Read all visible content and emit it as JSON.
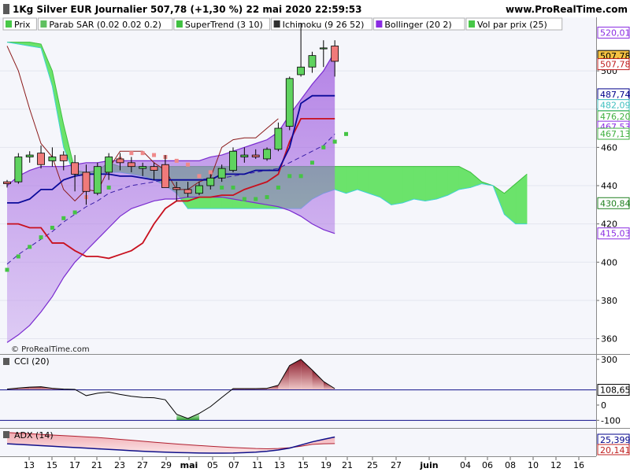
{
  "header": {
    "title": "1Kg Silver EUR Journalier 507,78 (+1,30 %) 22 mai 2020 22:59:53",
    "site": "www.ProRealTime.com"
  },
  "legend": [
    {
      "label": "Prix",
      "color": "#48c848"
    },
    {
      "label": "Parab SAR (0.02 0.02 0.2)",
      "color": "#60c060"
    },
    {
      "label": "SuperTrend (3 10)",
      "color": "#40c040"
    },
    {
      "label": "Ichimoku (9 26 52)",
      "color": "#303030"
    },
    {
      "label": "Bollinger (20 2)",
      "color": "#8a2be2"
    },
    {
      "label": "Vol par prix (25)",
      "color": "#48c848"
    }
  ],
  "watermark": "© ProRealTime.com",
  "chart_data": [
    {
      "type": "candlestick",
      "title": "",
      "x": [
        "13",
        "14",
        "15",
        "16",
        "17",
        "20",
        "21",
        "22",
        "23",
        "24",
        "27",
        "28",
        "29",
        "30",
        "mai",
        "04",
        "05",
        "06",
        "07",
        "08",
        "11",
        "12",
        "13",
        "14",
        "15",
        "18",
        "19",
        "20",
        "21",
        "22"
      ],
      "ohlc": [
        [
          442,
          443,
          439,
          441
        ],
        [
          442,
          457,
          441,
          455
        ],
        [
          455,
          458,
          452,
          456
        ],
        [
          457,
          461,
          449,
          451
        ],
        [
          453,
          460,
          450,
          455
        ],
        [
          456,
          458,
          448,
          453
        ],
        [
          452,
          456,
          437,
          446
        ],
        [
          447,
          451,
          430,
          437
        ],
        [
          436,
          452,
          435,
          450
        ],
        [
          447,
          457,
          443,
          455
        ],
        [
          454,
          457,
          448,
          452
        ],
        [
          452,
          455,
          447,
          450
        ],
        [
          449,
          452,
          445,
          450
        ],
        [
          450,
          452,
          443,
          448
        ],
        [
          451,
          456,
          442,
          439
        ],
        [
          439,
          442,
          432,
          438
        ],
        [
          438,
          442,
          434,
          436
        ],
        [
          436,
          442,
          435,
          440
        ],
        [
          440,
          446,
          438,
          444
        ],
        [
          444,
          451,
          442,
          449
        ],
        [
          448,
          460,
          447,
          458
        ],
        [
          455,
          460,
          452,
          456
        ],
        [
          456,
          459,
          454,
          455
        ],
        [
          454,
          460,
          453,
          459
        ],
        [
          459,
          473,
          458,
          470
        ],
        [
          471,
          497,
          469,
          496
        ],
        [
          498,
          525,
          497,
          502
        ],
        [
          502,
          510,
          499,
          508
        ],
        [
          512,
          516,
          502,
          512
        ],
        [
          513,
          516,
          497,
          505
        ]
      ],
      "price_axis": {
        "ticks": [
          360,
          380,
          400,
          420,
          440,
          460,
          480,
          500
        ],
        "range": [
          352,
          528
        ]
      },
      "price_labels": [
        {
          "text": "520,01",
          "value": 520.01,
          "color": "#8a2be2"
        },
        {
          "text": "507,78",
          "value": 507.78,
          "color": "#000000",
          "bg": "#f5c242"
        },
        {
          "text": "507,78",
          "value": 503.5,
          "color": "#c02020"
        },
        {
          "text": "487,74",
          "value": 487.74,
          "color": "#00008b"
        },
        {
          "text": "482,09",
          "value": 482.09,
          "color": "#40c0c0"
        },
        {
          "text": "476,20",
          "value": 476.2,
          "color": "#40b040"
        },
        {
          "text": "467,53",
          "value": 470.8,
          "color": "#8a2be2"
        },
        {
          "text": "467,13",
          "value": 467.13,
          "color": "#40b040"
        },
        {
          "text": "430,84",
          "value": 430.84,
          "color": "#208020"
        },
        {
          "text": "415,03",
          "value": 415.03,
          "color": "#8a2be2"
        }
      ],
      "bollinger_upper": [
        440,
        445,
        448,
        450,
        450,
        450,
        451,
        452,
        452,
        453,
        453,
        453,
        453,
        453,
        453,
        453,
        453,
        453,
        455,
        456,
        458,
        460,
        462,
        464,
        468,
        477,
        485,
        493,
        500,
        510
      ],
      "bollinger_lower": [
        358,
        362,
        367,
        374,
        382,
        392,
        400,
        406,
        412,
        418,
        424,
        428,
        430,
        432,
        433,
        433,
        434,
        434,
        434,
        434,
        433,
        432,
        431,
        430,
        429,
        427,
        424,
        420,
        417,
        415
      ],
      "bollinger_middle": [
        399,
        404,
        408,
        412,
        416,
        421,
        425,
        429,
        432,
        436,
        438,
        440,
        441,
        442,
        443,
        443,
        443,
        443,
        444,
        444,
        445,
        446,
        447,
        448,
        449,
        452,
        455,
        458,
        461,
        467
      ],
      "tenkan": [
        431,
        431,
        433,
        438,
        438,
        443,
        445,
        446,
        446,
        446,
        445,
        445,
        444,
        443,
        443,
        443,
        443,
        443,
        443,
        446,
        446,
        446,
        448,
        448,
        448,
        460,
        483,
        487,
        487,
        487
      ],
      "kijun": [
        420,
        420,
        418,
        418,
        410,
        410,
        406,
        403,
        403,
        402,
        404,
        406,
        410,
        420,
        428,
        432,
        432,
        434,
        434,
        435,
        435,
        438,
        440,
        442,
        446,
        463,
        475,
        475,
        475,
        475
      ],
      "chikou": [
        513,
        500,
        480,
        462,
        455,
        438,
        432,
        438,
        437,
        449,
        458,
        458,
        458,
        452,
        448,
        438,
        438,
        442,
        444,
        460,
        464,
        465,
        465,
        470,
        475
      ],
      "senkou_a": [
        515,
        515,
        515,
        514,
        500,
        472,
        448,
        447,
        448,
        452,
        450,
        450,
        450,
        450,
        450,
        450,
        450,
        450,
        450,
        450,
        450,
        450,
        450,
        450,
        450,
        450,
        450,
        450,
        450,
        450,
        450,
        450,
        450,
        450,
        450,
        450,
        450,
        450,
        450,
        450,
        450,
        447,
        442,
        440,
        436,
        441,
        446,
        450
      ],
      "senkou_b": [
        515,
        514,
        513,
        512,
        492,
        460,
        445,
        446,
        446,
        447,
        447,
        446,
        445,
        443,
        440,
        436,
        428,
        428,
        428,
        428,
        428,
        428,
        428,
        428,
        428,
        428,
        428,
        433,
        436,
        438,
        436,
        438,
        436,
        434,
        430,
        431,
        433,
        432,
        433,
        435,
        438,
        439,
        441,
        440,
        425,
        420,
        420
      ],
      "psar": [
        [
          396,
          0
        ],
        [
          403,
          1
        ],
        [
          408,
          2
        ],
        [
          413,
          3
        ],
        [
          418,
          4
        ],
        [
          423,
          5
        ],
        [
          426,
          6
        ],
        [
          434,
          7
        ],
        [
          437,
          8
        ],
        [
          439,
          9
        ],
        [
          454,
          10
        ],
        [
          457,
          11
        ],
        [
          457,
          12
        ],
        [
          456,
          13
        ],
        [
          455,
          14
        ],
        [
          453,
          15
        ],
        [
          451,
          16
        ],
        [
          445,
          17
        ],
        [
          447,
          18
        ],
        [
          439,
          19
        ],
        [
          439,
          20
        ],
        [
          433,
          21
        ],
        [
          433,
          22
        ],
        [
          434,
          23
        ],
        [
          439,
          24
        ],
        [
          445,
          25
        ],
        [
          445,
          26
        ],
        [
          452,
          27
        ],
        [
          460,
          28
        ],
        [
          463,
          29
        ],
        [
          467,
          30
        ]
      ],
      "supertrend": [
        [
          381,
          0
        ],
        [
          393,
          1
        ],
        [
          399,
          3
        ],
        [
          406,
          5
        ],
        [
          404,
          6
        ],
        [
          404,
          7
        ],
        [
          405,
          8
        ],
        [
          405,
          9
        ],
        [
          405,
          10
        ],
        [
          405,
          11
        ],
        [
          406,
          12
        ],
        [
          410,
          13
        ],
        [
          425,
          14
        ],
        [
          425,
          15
        ],
        [
          425,
          16
        ],
        [
          425,
          17
        ],
        [
          425,
          18
        ],
        [
          426,
          19
        ],
        [
          426,
          20
        ],
        [
          426,
          21
        ],
        [
          426,
          22
        ],
        [
          430,
          23
        ],
        [
          438,
          24
        ],
        [
          450,
          25
        ],
        [
          465,
          26
        ],
        [
          465,
          27
        ],
        [
          467,
          28
        ],
        [
          469,
          29
        ]
      ],
      "dates_axis": [
        "13",
        "15",
        "17",
        "21",
        "23",
        "27",
        "29",
        "mai",
        "05",
        "07",
        "11",
        "13",
        "15",
        "19",
        "21",
        "25",
        "27",
        "juin",
        "04",
        "06",
        "08",
        "10",
        "12",
        "16",
        "18"
      ]
    },
    {
      "type": "line",
      "title": "CCI (20)",
      "y_ticks": [
        300,
        0,
        -100
      ],
      "current_label": "108,65",
      "values": [
        105,
        112,
        118,
        120,
        110,
        105,
        103,
        62,
        78,
        85,
        70,
        58,
        50,
        48,
        35,
        -60,
        -88,
        -55,
        -10,
        50,
        108,
        108,
        108,
        110,
        130,
        260,
        300,
        230,
        155,
        108
      ]
    },
    {
      "type": "line",
      "title": "ADX (14)",
      "y_ticks": [],
      "labels": [
        {
          "text": "25,399",
          "color": "#00008b"
        },
        {
          "text": "20,141",
          "color": "#c02020"
        }
      ],
      "adx": [
        20,
        19.5,
        19,
        18.5,
        18,
        17.5,
        17,
        16.5,
        16,
        15.5,
        15,
        14.5,
        14,
        13.6,
        13.3,
        13,
        12.8,
        12.6,
        12.5,
        12.5,
        12.6,
        12.9,
        13.3,
        14,
        15,
        16.5,
        19,
        21.5,
        23.5,
        25.4
      ],
      "di_plus": [
        29,
        28.5,
        28,
        27.5,
        27,
        26.5,
        26,
        25.5,
        25,
        24.3,
        23.5,
        22.8,
        22,
        21.2,
        20.5,
        19.8,
        19.2,
        18.6,
        18,
        17.5,
        17,
        16.6,
        16.2,
        16,
        16.2,
        16.8,
        18,
        19.5,
        20,
        20.1
      ]
    }
  ]
}
